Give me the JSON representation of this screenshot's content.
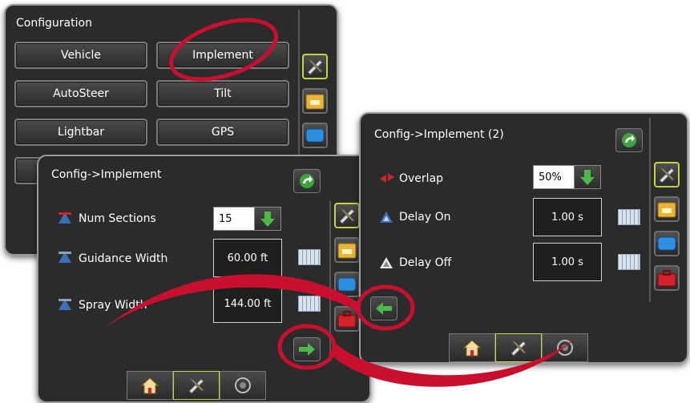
{
  "config_panel": {
    "title": "Configuration",
    "buttons": [
      "Vehicle",
      "Implement",
      "AutoSteer",
      "Tilt",
      "Lightbar",
      "GPS"
    ]
  },
  "implement_panel": {
    "title": "Config->Implement",
    "rows": [
      {
        "label": "Num Sections",
        "value": "15"
      },
      {
        "label": "Guidance Width",
        "value": "60.00 ft"
      },
      {
        "label": "Spray Width",
        "value": "144.00 ft"
      }
    ]
  },
  "implement2_panel": {
    "title": "Config->Implement (2)",
    "rows": [
      {
        "label": "Overlap",
        "value": "50%"
      },
      {
        "label": "Delay On",
        "value": "1.00 s"
      },
      {
        "label": "Delay Off",
        "value": "1.00 s"
      }
    ]
  },
  "colors": {
    "panel_bg": "#2b2b2b",
    "annotation_red": "#c8102e",
    "green_arrow": "#3da33a",
    "active_border": "#c8d23a"
  },
  "icons": {
    "side": [
      "tools-icon",
      "folder-icon",
      "display-icon",
      "toolbox-icon"
    ],
    "bottom": [
      "home-icon",
      "tools-icon",
      "camera-icon"
    ]
  }
}
